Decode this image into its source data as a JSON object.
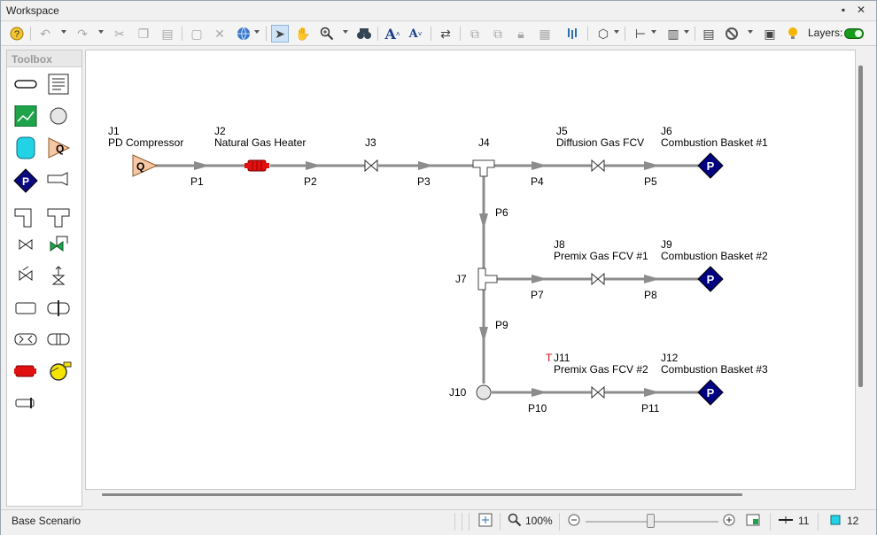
{
  "window": {
    "title": "Workspace",
    "pin_icon": "pin-icon",
    "close_icon": "close-icon"
  },
  "toolbar": {
    "layers_label": "Layers:",
    "buttons": [
      "help",
      "undo",
      "redo",
      "cut",
      "copy",
      "paste",
      "select-all",
      "delete",
      "globe",
      "pointer",
      "pan",
      "zoom",
      "find",
      "font-larger",
      "font-smaller",
      "reverse",
      "bring-front",
      "send-back",
      "lock",
      "snap",
      "connect",
      "align",
      "grid",
      "arrange",
      "properties",
      "disable",
      "legend",
      "hints",
      "layers"
    ]
  },
  "toolbox": {
    "title": "Toolbox"
  },
  "model": {
    "junctions": [
      {
        "id": "J1",
        "name": "PD Compressor",
        "symbol": "Q"
      },
      {
        "id": "J2",
        "name": "Natural Gas Heater"
      },
      {
        "id": "J3",
        "name": ""
      },
      {
        "id": "J4",
        "name": ""
      },
      {
        "id": "J5",
        "name": "Diffusion Gas FCV"
      },
      {
        "id": "J6",
        "name": "Combustion Basket #1",
        "symbol": "P"
      },
      {
        "id": "J7",
        "name": ""
      },
      {
        "id": "J8",
        "name": "Premix Gas FCV #1"
      },
      {
        "id": "J9",
        "name": "Combustion Basket #2",
        "symbol": "P"
      },
      {
        "id": "J10",
        "name": ""
      },
      {
        "id": "J11",
        "name": "Premix Gas FCV #2",
        "flag": "T"
      },
      {
        "id": "J12",
        "name": "Combustion Basket #3",
        "symbol": "P"
      }
    ],
    "pipes": [
      "P1",
      "P2",
      "P3",
      "P4",
      "P5",
      "P6",
      "P7",
      "P8",
      "P9",
      "P10",
      "P11"
    ]
  },
  "status": {
    "scenario": "Base Scenario",
    "zoom": "100%",
    "zoom_level": 0.5,
    "pipe_count": "11",
    "junction_count": "12"
  },
  "colors": {
    "canvas": "#ffffff",
    "pipe": "#8c8c8c",
    "terminal": "#000080",
    "heater": "#dd0000",
    "compressor": "#f7c7a4",
    "layers_on": "#1a9a1a"
  }
}
